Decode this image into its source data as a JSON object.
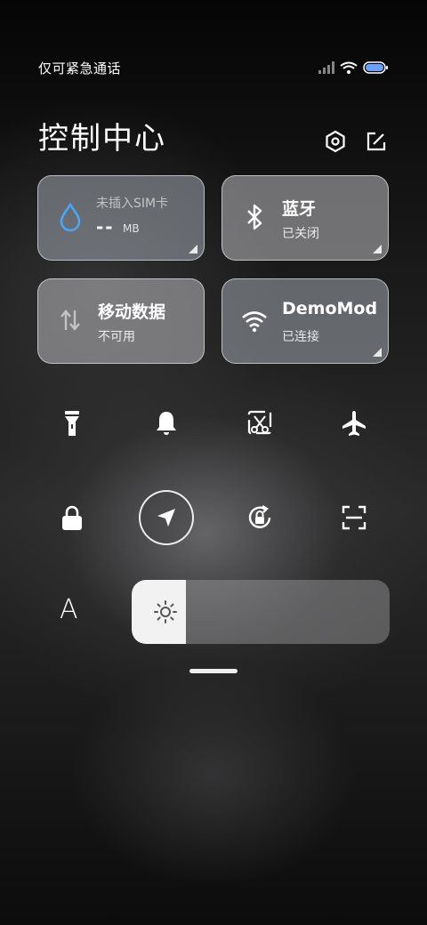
{
  "status": {
    "carrier": "仅可紧急通话"
  },
  "header": {
    "title": "控制中心"
  },
  "tiles": {
    "sim": {
      "subtitle": "未插入SIM卡",
      "value": "--",
      "unit": "MB"
    },
    "bluetooth": {
      "title": "蓝牙",
      "subtitle": "已关闭"
    },
    "mobile_data": {
      "title": "移动数据",
      "subtitle": "不可用"
    },
    "wifi": {
      "title": "DemoMod",
      "subtitle": "已连接"
    }
  },
  "quick_toggles": [
    {
      "name": "flashlight",
      "active": false
    },
    {
      "name": "mute-bell",
      "active": false
    },
    {
      "name": "screenshot",
      "active": false
    },
    {
      "name": "airplane-mode",
      "active": false
    },
    {
      "name": "lock-screen",
      "active": false
    },
    {
      "name": "location",
      "active": true
    },
    {
      "name": "rotation-lock",
      "active": false
    },
    {
      "name": "scanner",
      "active": false
    }
  ],
  "brightness": {
    "auto_label": "A",
    "level": 0.21
  },
  "colors": {
    "tile": "#aaaaac",
    "accent_drop": "#4aa6f5",
    "battery": "#6aa0ff"
  }
}
